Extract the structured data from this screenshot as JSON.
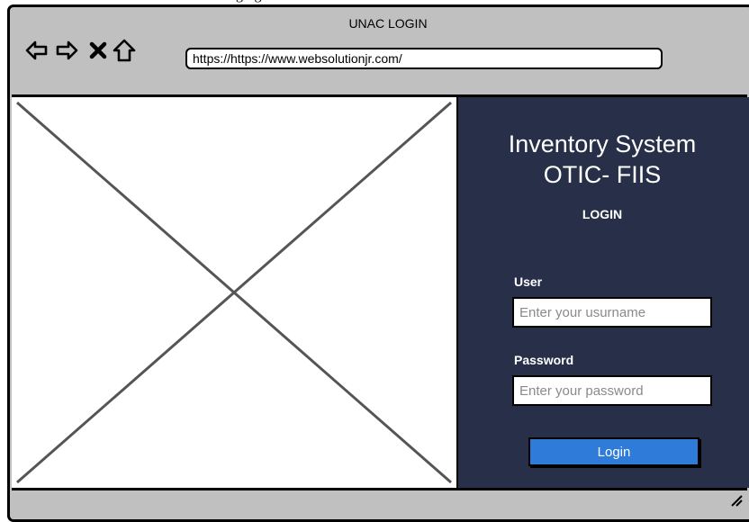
{
  "caption": "loging",
  "window": {
    "title": "UNAC LOGIN"
  },
  "nav": {
    "back_icon": "back-arrow-icon",
    "forward_icon": "forward-arrow-icon",
    "stop_icon": "close-icon",
    "home_icon": "home-icon",
    "url": "https://https://www.websolutionjr.com/"
  },
  "login": {
    "title_line1": "Inventory System",
    "title_line2": "OTIC- FIIS",
    "heading": "LOGIN",
    "user_label": "User",
    "user_placeholder": "Enter your usurname",
    "password_label": "Password",
    "password_placeholder": "Enter your password",
    "button_label": "Login"
  },
  "colors": {
    "panel_bg": "#273048",
    "button_bg": "#2e7bd9",
    "chrome_bg": "#c0c0c0"
  }
}
